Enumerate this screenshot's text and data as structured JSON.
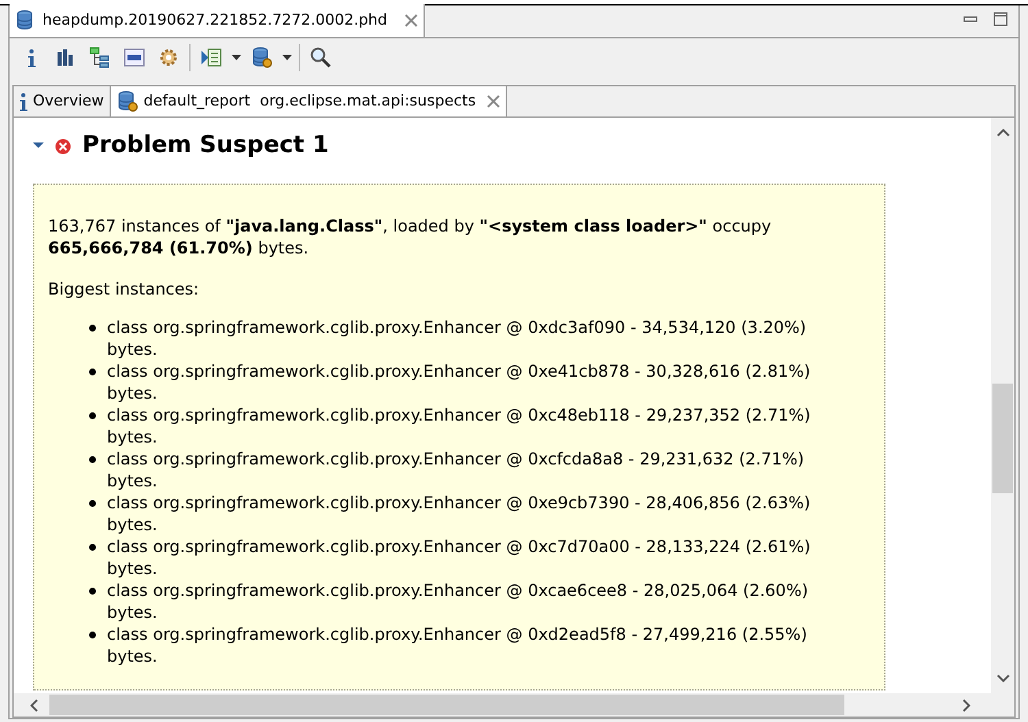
{
  "editor_tab": {
    "title": "heapdump.20190627.221852.7272.0002.phd"
  },
  "report_tabs": [
    {
      "label": "Overview",
      "kind": "info",
      "selected": false
    },
    {
      "label": "default_report  org.eclipse.mat.api:suspects",
      "kind": "report",
      "selected": true
    }
  ],
  "suspect": {
    "title": "Problem Suspect 1",
    "expanded": true,
    "summary": "163,767 instances of **\"java.lang.Class\"**, loaded by **\"<system class loader>\"** occupy **665,666,784 (61.70%)** bytes.",
    "biggest_label": "Biggest instances:",
    "instances": [
      "class org.springframework.cglib.proxy.Enhancer @ 0xdc3af090 - 34,534,120 (3.20%) bytes.",
      "class org.springframework.cglib.proxy.Enhancer @ 0xe41cb878 - 30,328,616 (2.81%) bytes.",
      "class org.springframework.cglib.proxy.Enhancer @ 0xc48eb118 - 29,237,352 (2.71%) bytes.",
      "class org.springframework.cglib.proxy.Enhancer @ 0xcfcda8a8 - 29,231,632 (2.71%) bytes.",
      "class org.springframework.cglib.proxy.Enhancer @ 0xe9cb7390 - 28,406,856 (2.63%) bytes.",
      "class org.springframework.cglib.proxy.Enhancer @ 0xc7d70a00 - 28,133,224 (2.61%) bytes.",
      "class org.springframework.cglib.proxy.Enhancer @ 0xcae6cee8 - 28,025,064 (2.60%) bytes.",
      "class org.springframework.cglib.proxy.Enhancer @ 0xd2ead5f8 - 27,499,216 (2.55%) bytes."
    ]
  }
}
